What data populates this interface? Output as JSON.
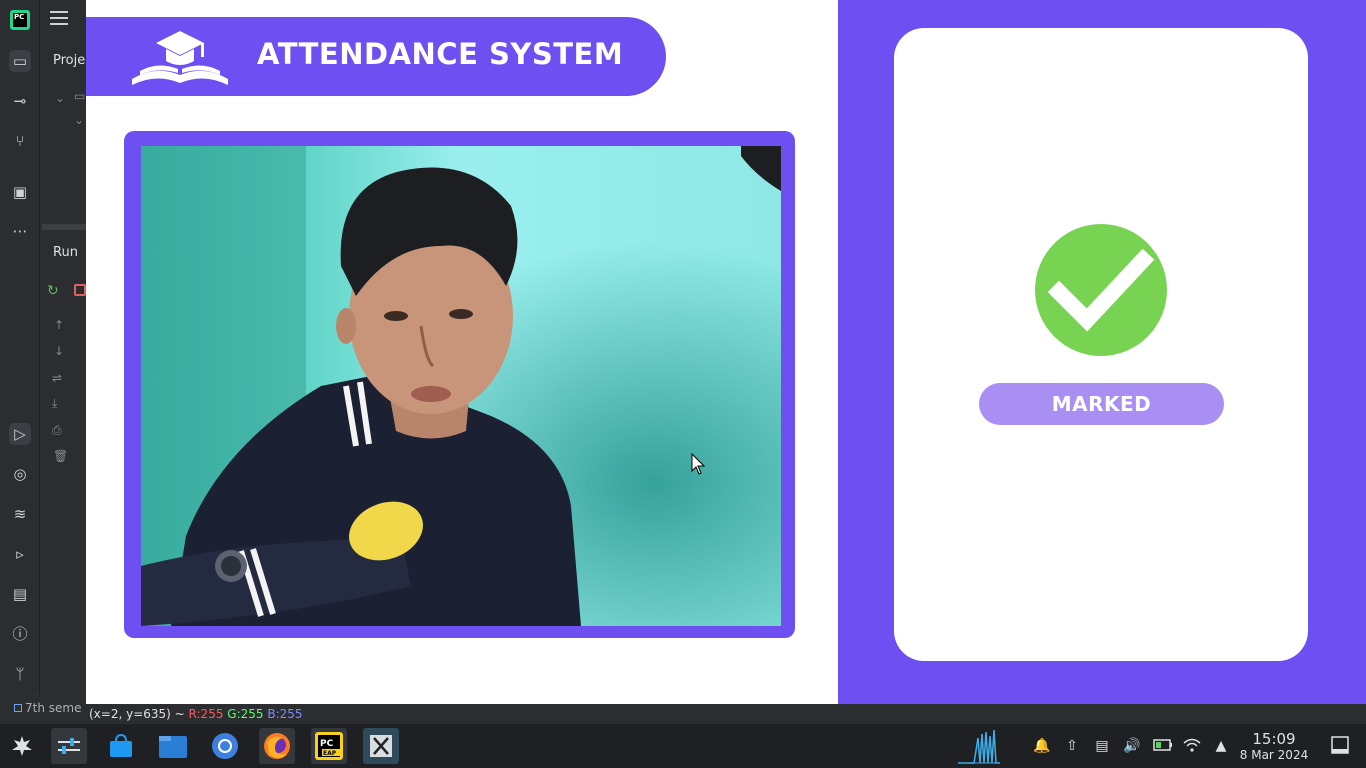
{
  "ide": {
    "project_label": "Proje",
    "run_label": "Run",
    "status_text": "7th seme",
    "logo_text": "PC"
  },
  "app": {
    "header_title": "ATTENDANCE SYSTEM",
    "status_label": "MARKED",
    "accent_color": "#6d4ff2",
    "success_color": "#78d352",
    "badge_color": "#a98ff4"
  },
  "cv_status": {
    "coords": "(x=2, y=635) ~",
    "r": "R:255",
    "g": "G:255",
    "b": "B:255"
  },
  "taskbar": {
    "apps": [
      "app-launcher-icon",
      "system-settings-icon",
      "store-icon",
      "file-manager-icon",
      "chromium-icon",
      "firefox-icon",
      "pycharm-icon",
      "x-window-icon"
    ],
    "tray": [
      "notifications-icon",
      "updates-icon",
      "clipboard-icon",
      "volume-icon",
      "battery-icon",
      "wifi-icon",
      "expand-tray-icon"
    ],
    "time": "15:09",
    "date": "8 Mar 2024",
    "pycharm_badge": "EAP"
  }
}
